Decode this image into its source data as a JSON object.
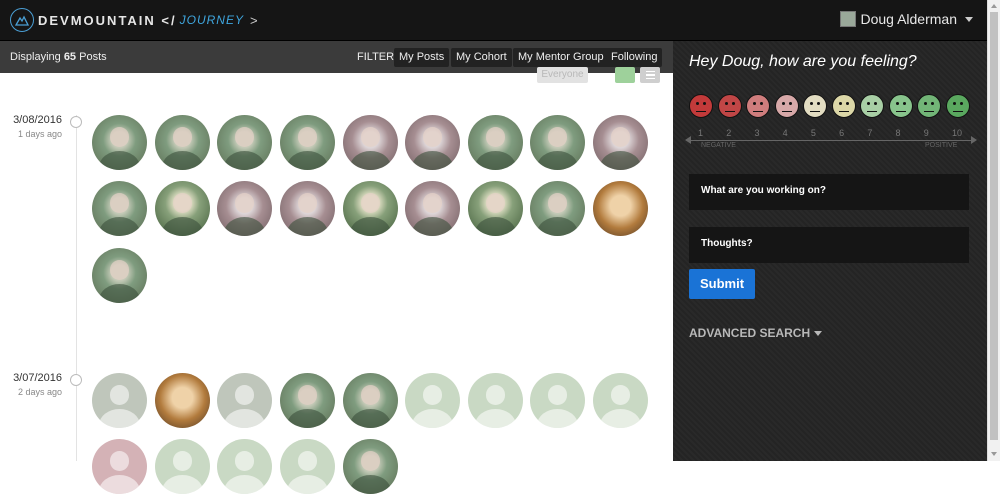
{
  "nav": {
    "logo_text": "DEVMOUNTAIN </",
    "logo_journey": "JOURNEY",
    "logo_chevron": ">",
    "user_name": "Doug Alderman"
  },
  "filterbar": {
    "displaying_prefix": "Displaying ",
    "count": "65",
    "displaying_suffix": " Posts",
    "filter_label": "FILTER:",
    "buttons": [
      "My Posts",
      "My Cohort",
      "My Mentor Group",
      "Following"
    ],
    "everyone": "Everyone"
  },
  "feed": {
    "groups": [
      {
        "date": "3/08/2016",
        "ago": "1 days ago"
      },
      {
        "date": "3/07/2016",
        "ago": "2 days ago"
      }
    ]
  },
  "panel": {
    "title": "Hey Doug, how are you feeling?",
    "mood_colors": [
      "#c23a3a",
      "#c04646",
      "#cf7d7d",
      "#d7a8a8",
      "#e3ddc2",
      "#dcd7a7",
      "#a8cfa5",
      "#88c48c",
      "#72b577",
      "#5aa85f"
    ],
    "scale_numbers": [
      "1",
      "2",
      "3",
      "4",
      "5",
      "6",
      "7",
      "8",
      "9",
      "10"
    ],
    "negative": "NEGATIVE",
    "positive": "POSITIVE",
    "working_on_placeholder": "What are you working on?",
    "thoughts_placeholder": "Thoughts?",
    "submit": "Submit",
    "advanced_search": "ADVANCED SEARCH"
  }
}
